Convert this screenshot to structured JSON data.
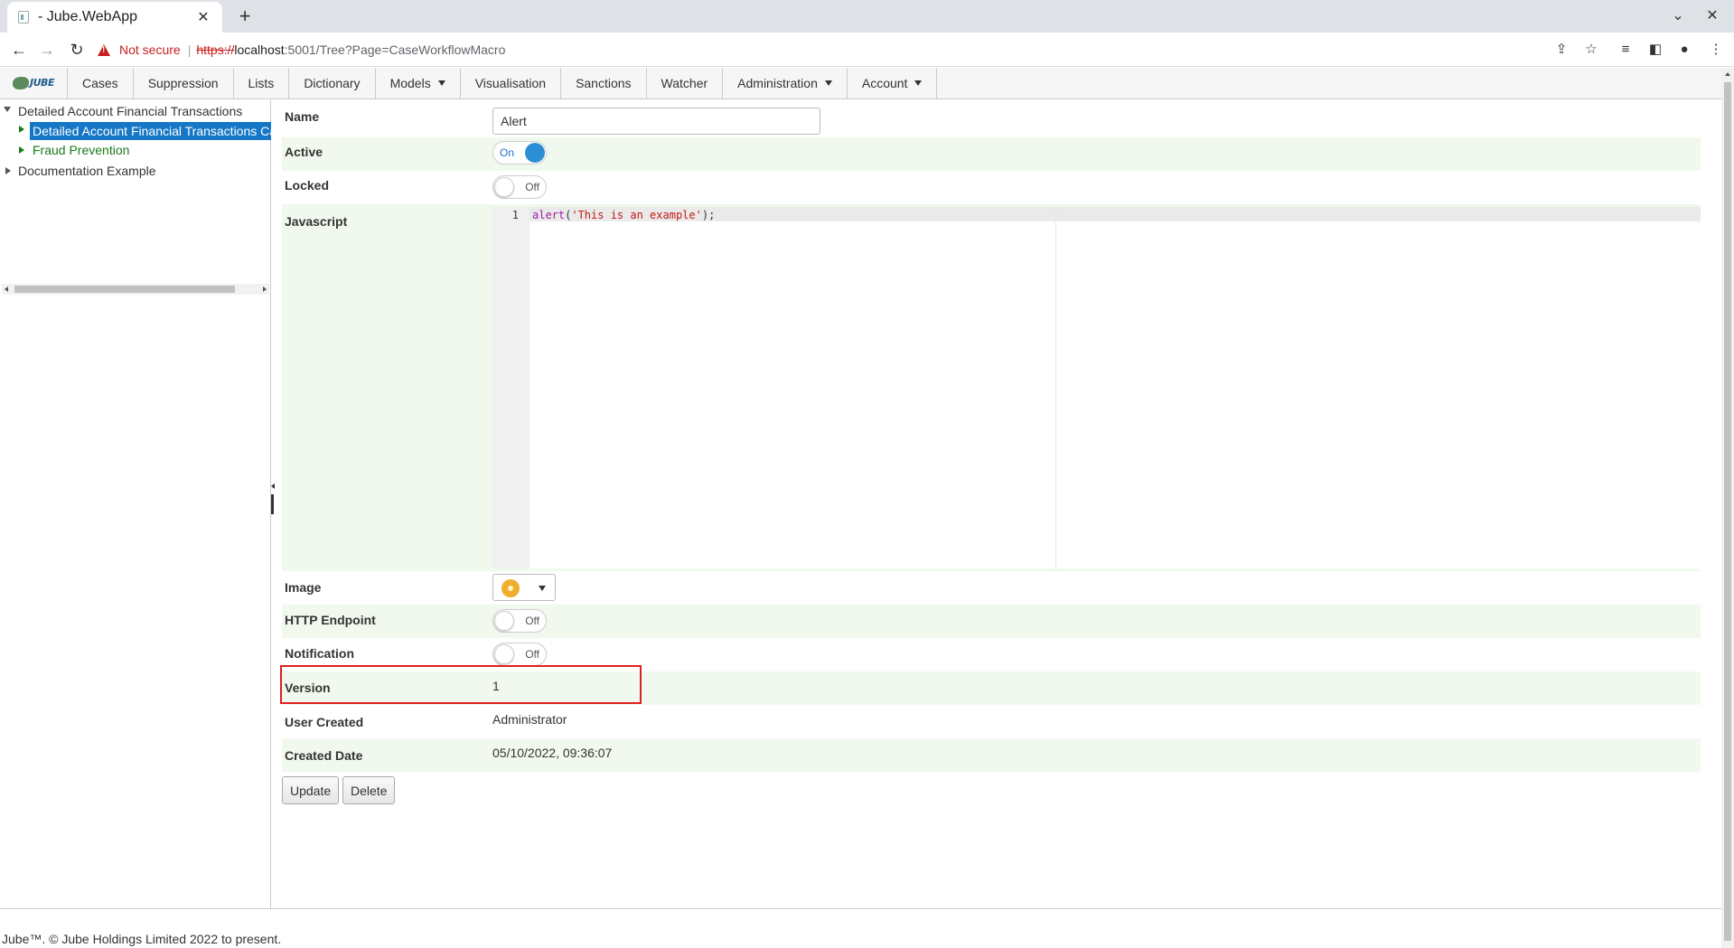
{
  "browser": {
    "tab_title": "- Jube.WebApp",
    "security_label": "Not secure",
    "url_scheme": "https://",
    "url_host": "localhost",
    "url_path": ":5001/Tree?Page=CaseWorkflowMacro"
  },
  "nav": {
    "logo_text": "JUBE",
    "items": [
      "Cases",
      "Suppression",
      "Lists",
      "Dictionary",
      "Models",
      "Visualisation",
      "Sanctions",
      "Watcher",
      "Administration",
      "Account"
    ]
  },
  "tree": {
    "root": "Detailed Account Financial Transactions",
    "selected": "Detailed Account Financial Transactions Case Workflow",
    "child2": "Fraud Prevention",
    "root2": "Documentation Example"
  },
  "form": {
    "name_label": "Name",
    "name_value": "Alert",
    "active_label": "Active",
    "active_state": "On",
    "locked_label": "Locked",
    "locked_state": "Off",
    "javascript_label": "Javascript",
    "code_line_number": "1",
    "code_fn": "alert",
    "code_open": "(",
    "code_str": "'This is an example'",
    "code_close": ");",
    "image_label": "Image",
    "http_label": "HTTP Endpoint",
    "http_state": "Off",
    "notification_label": "Notification",
    "notification_state": "Off",
    "version_label": "Version",
    "version_value": "1",
    "user_created_label": "User Created",
    "user_created_value": "Administrator",
    "created_date_label": "Created Date",
    "created_date_value": "05/10/2022, 09:36:07"
  },
  "buttons": {
    "update": "Update",
    "delete": "Delete"
  },
  "footer": "Jube™. © Jube Holdings Limited 2022 to present.",
  "colors": {
    "accent": "#1577c6",
    "row_shade": "#f1f9ee",
    "highlight": "#e02020",
    "tree_green": "#1a7a1a"
  }
}
